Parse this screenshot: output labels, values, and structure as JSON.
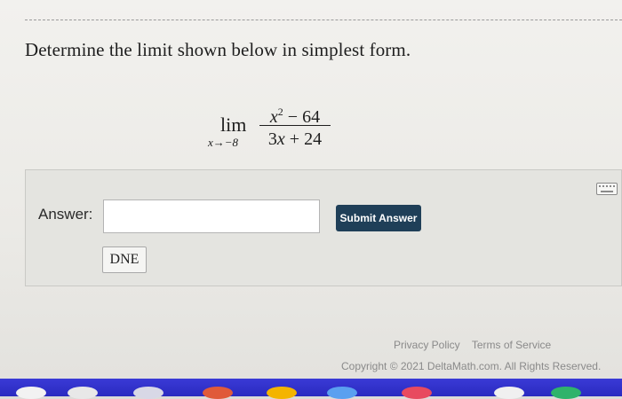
{
  "question": {
    "prompt": "Determine the limit shown below in simplest form."
  },
  "expression": {
    "lim_word": "lim",
    "subscript": "x→−8",
    "numerator_var": "x",
    "numerator_exp": "2",
    "numerator_rest": " − 64",
    "denominator_coef": "3",
    "denominator_var": "x",
    "denominator_rest": " + 24"
  },
  "answer": {
    "label": "Answer:",
    "input_value": "",
    "submit_label": "Submit Answer",
    "dne_label": "DNE"
  },
  "footer": {
    "privacy": "Privacy Policy",
    "terms": "Terms of Service",
    "copyright": "Copyright © 2021 DeltaMath.com. All Rights Reserved."
  },
  "colors": {
    "submit_bg": "#1f3f58",
    "dock": "#2a2ac0"
  },
  "icons": [
    "keyboard-icon"
  ]
}
